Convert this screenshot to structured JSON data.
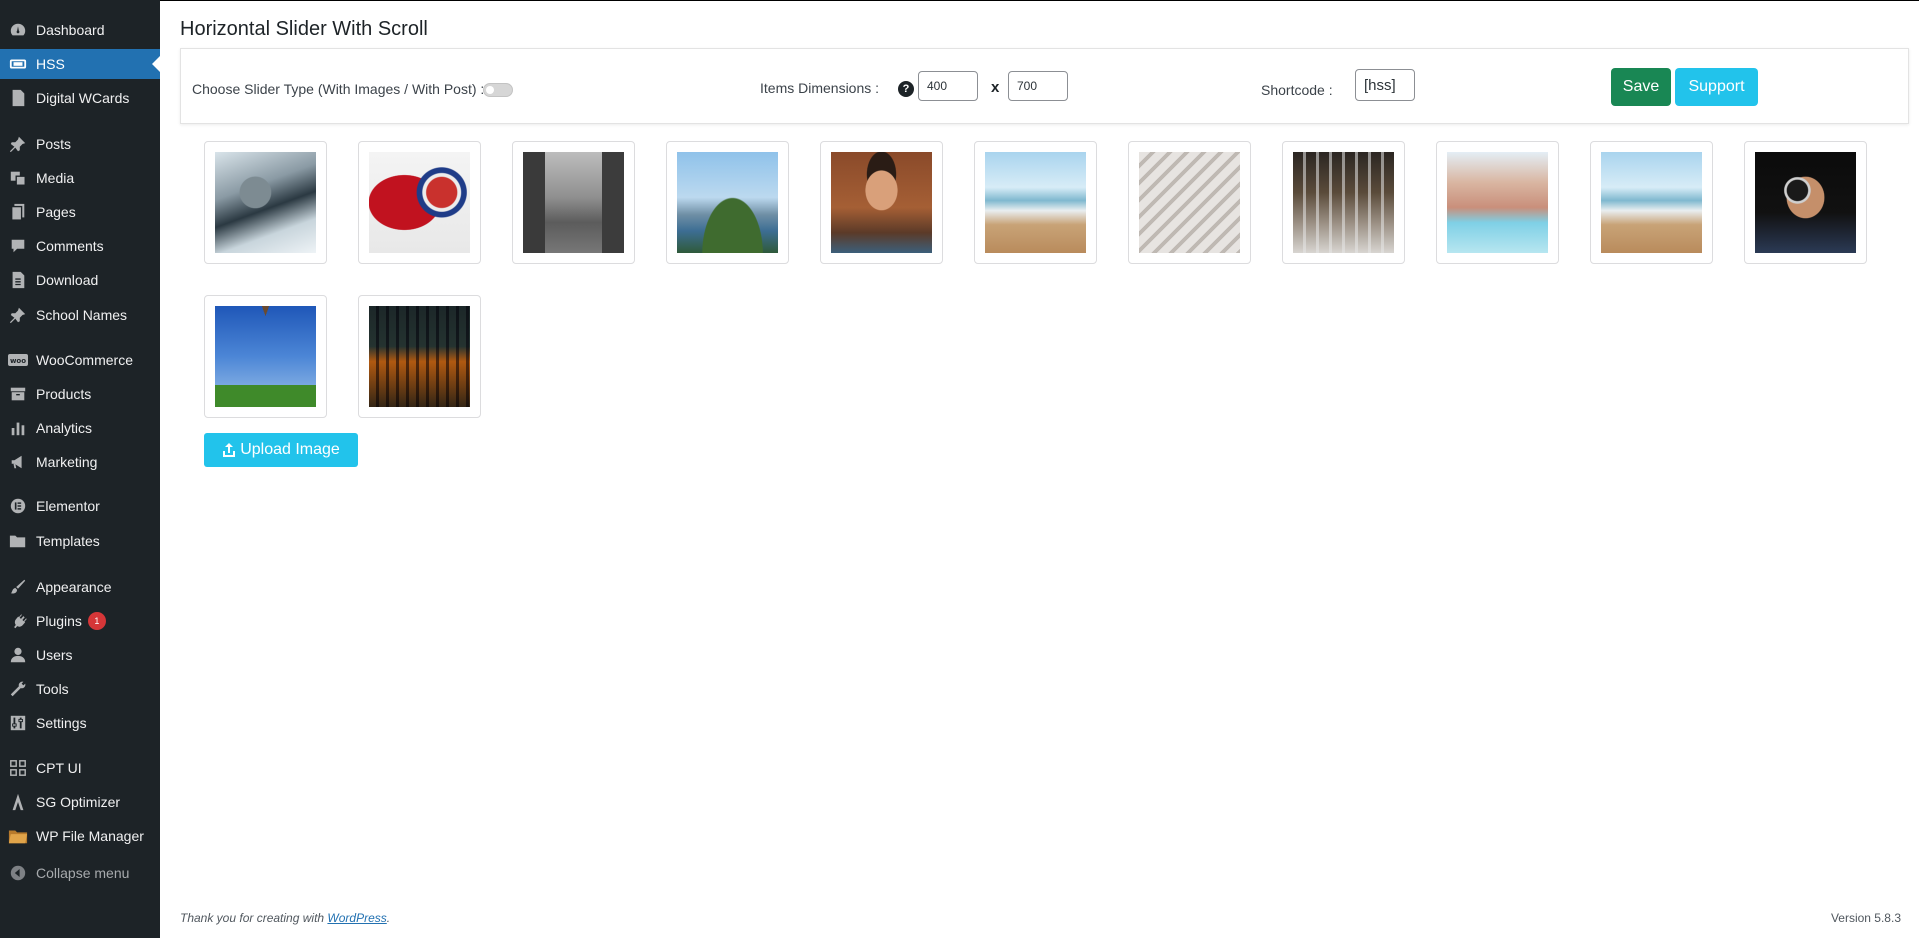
{
  "sidebar": {
    "items": [
      {
        "name": "dashboard",
        "label": "Dashboard",
        "icon": "dashboard-icon"
      },
      {
        "name": "hss",
        "label": "HSS",
        "icon": "slides-icon",
        "active": true
      },
      {
        "name": "digital-wcards",
        "label": "Digital WCards",
        "icon": "page-icon"
      },
      {
        "name": "posts",
        "label": "Posts",
        "icon": "pin-icon"
      },
      {
        "name": "media",
        "label": "Media",
        "icon": "media-icon"
      },
      {
        "name": "pages",
        "label": "Pages",
        "icon": "page-icon"
      },
      {
        "name": "comments",
        "label": "Comments",
        "icon": "comment-icon"
      },
      {
        "name": "download",
        "label": "Download",
        "icon": "page-icon"
      },
      {
        "name": "school-names",
        "label": "School Names",
        "icon": "pin-icon"
      },
      {
        "name": "woocommerce",
        "label": "WooCommerce",
        "icon": "woo-icon"
      },
      {
        "name": "products",
        "label": "Products",
        "icon": "archive-icon"
      },
      {
        "name": "analytics",
        "label": "Analytics",
        "icon": "chart-icon"
      },
      {
        "name": "marketing",
        "label": "Marketing",
        "icon": "megaphone-icon"
      },
      {
        "name": "elementor",
        "label": "Elementor",
        "icon": "elementor-icon"
      },
      {
        "name": "templates",
        "label": "Templates",
        "icon": "folder-icon"
      },
      {
        "name": "appearance",
        "label": "Appearance",
        "icon": "brush-icon"
      },
      {
        "name": "plugins",
        "label": "Plugins",
        "icon": "plugin-icon",
        "badge": "1"
      },
      {
        "name": "users",
        "label": "Users",
        "icon": "user-icon"
      },
      {
        "name": "tools",
        "label": "Tools",
        "icon": "wrench-icon"
      },
      {
        "name": "settings",
        "label": "Settings",
        "icon": "settings-icon"
      },
      {
        "name": "cpt-ui",
        "label": "CPT UI",
        "icon": "grid-icon"
      },
      {
        "name": "sg-optimizer",
        "label": "SG Optimizer",
        "icon": "sg-icon"
      },
      {
        "name": "wp-file-manager",
        "label": "WP File Manager",
        "icon": "file-manager-icon"
      },
      {
        "name": "collapse-menu",
        "label": "Collapse menu",
        "icon": "collapse-icon"
      }
    ]
  },
  "page": {
    "title": "Horizontal Slider With Scroll"
  },
  "settings": {
    "slider_type_label": "Choose Slider Type (With Images / With Post) :",
    "dimensions_label": "Items Dimensions :",
    "help_glyph": "?",
    "width_value": "400",
    "times_sign": "x",
    "height_value": "700",
    "shortcode_label": "Shortcode :",
    "shortcode_value": "[hss]",
    "save_label": "Save",
    "support_label": "Support"
  },
  "gallery": {
    "images": [
      {
        "name": "armored-hero-image"
      },
      {
        "name": "spiderman-image"
      },
      {
        "name": "city-street-image"
      },
      {
        "name": "rio-statue-image"
      },
      {
        "name": "smiling-man-image"
      },
      {
        "name": "beach-family-image"
      },
      {
        "name": "striped-pillows-image"
      },
      {
        "name": "wine-glasses-image"
      },
      {
        "name": "resort-pool-image"
      },
      {
        "name": "beach-family-image-2"
      },
      {
        "name": "photographer-image"
      },
      {
        "name": "eiffel-tower-image"
      },
      {
        "name": "colosseum-image"
      }
    ],
    "upload_label": "Upload Image"
  },
  "footer": {
    "thanks_text": "Thank you for creating with",
    "link_text": "WordPress",
    "period": ".",
    "version": "Version 5.8.3"
  },
  "colors": {
    "sidebar_bg": "#1d2327",
    "active_menu": "#2271b1",
    "save_button": "#198754",
    "support_button": "#22c3eb",
    "badge": "#d63638"
  }
}
